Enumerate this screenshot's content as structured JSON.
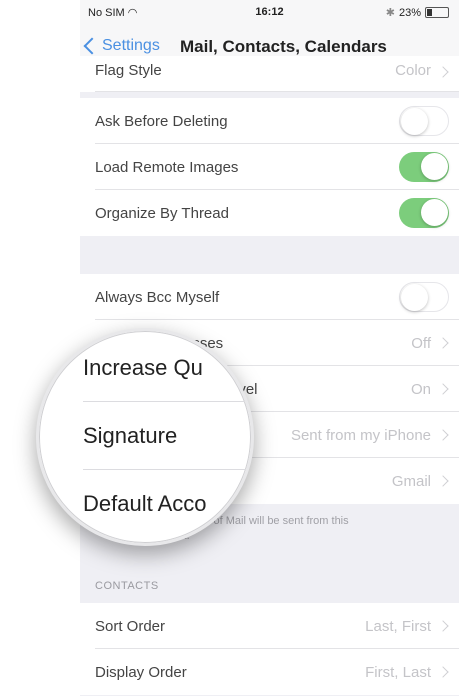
{
  "status_bar": {
    "carrier": "No SIM",
    "wifi_icon": "wifi-icon",
    "time": "16:12",
    "bluetooth": "✱",
    "battery_percent": "23%",
    "battery_level": 0.23
  },
  "nav": {
    "back_label": "Settings",
    "title": "Mail, Contacts, Calendars"
  },
  "rows": {
    "flag_style": {
      "label": "Flag Style",
      "value": "Color"
    },
    "ask_before_deleting": {
      "label": "Ask Before Deleting",
      "on": false
    },
    "load_remote_images": {
      "label": "Load Remote Images",
      "on": true
    },
    "organize_by_thread": {
      "label": "Organize By Thread",
      "on": true
    },
    "always_bcc": {
      "label": "Always Bcc Myself",
      "on": false
    },
    "mark_addresses": {
      "label": "asses",
      "value": "Off"
    },
    "increase_quote_level": {
      "label": "evel",
      "value": "On"
    },
    "signature": {
      "value": "Sent from my iPhone"
    },
    "default_account": {
      "value": "Gmail"
    }
  },
  "footer_note": {
    "line1": "outside of Mail will be sent from this",
    "line2": "ult."
  },
  "contacts_header": "CONTACTS",
  "contacts_rows": {
    "sort_order": {
      "label": "Sort Order",
      "value": "Last, First"
    },
    "display_order": {
      "label": "Display Order",
      "value": "First, Last"
    }
  },
  "magnifier": {
    "row1": "Increase Qu",
    "row2": "Signature",
    "row3": "Default Acco"
  },
  "colors": {
    "accent": "#4a90e2",
    "toggle_on": "#7ccd7c",
    "background": "#efeff4"
  }
}
